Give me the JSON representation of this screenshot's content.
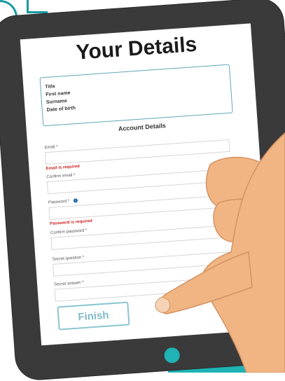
{
  "page": {
    "title": "Your Details",
    "personal_fields": [
      "Title",
      "First name",
      "Surname",
      "Date of birth"
    ],
    "section_title": "Account Details",
    "fields": {
      "email_label": "Email *",
      "email_error": "Email is required",
      "confirm_email_label": "Confirm email *",
      "password_label": "Password *",
      "password_info_icon": "i",
      "password_error": "Password is required",
      "confirm_password_label": "Confirm password *",
      "secret_question_label": "Secret question *",
      "secret_answer_label": "Secret answer *"
    },
    "finish_label": "Finish"
  },
  "colors": {
    "accent": "#1fb3b5",
    "tablet": "#3a3a3a",
    "error": "#cc2222",
    "skin": "#f1b483"
  }
}
